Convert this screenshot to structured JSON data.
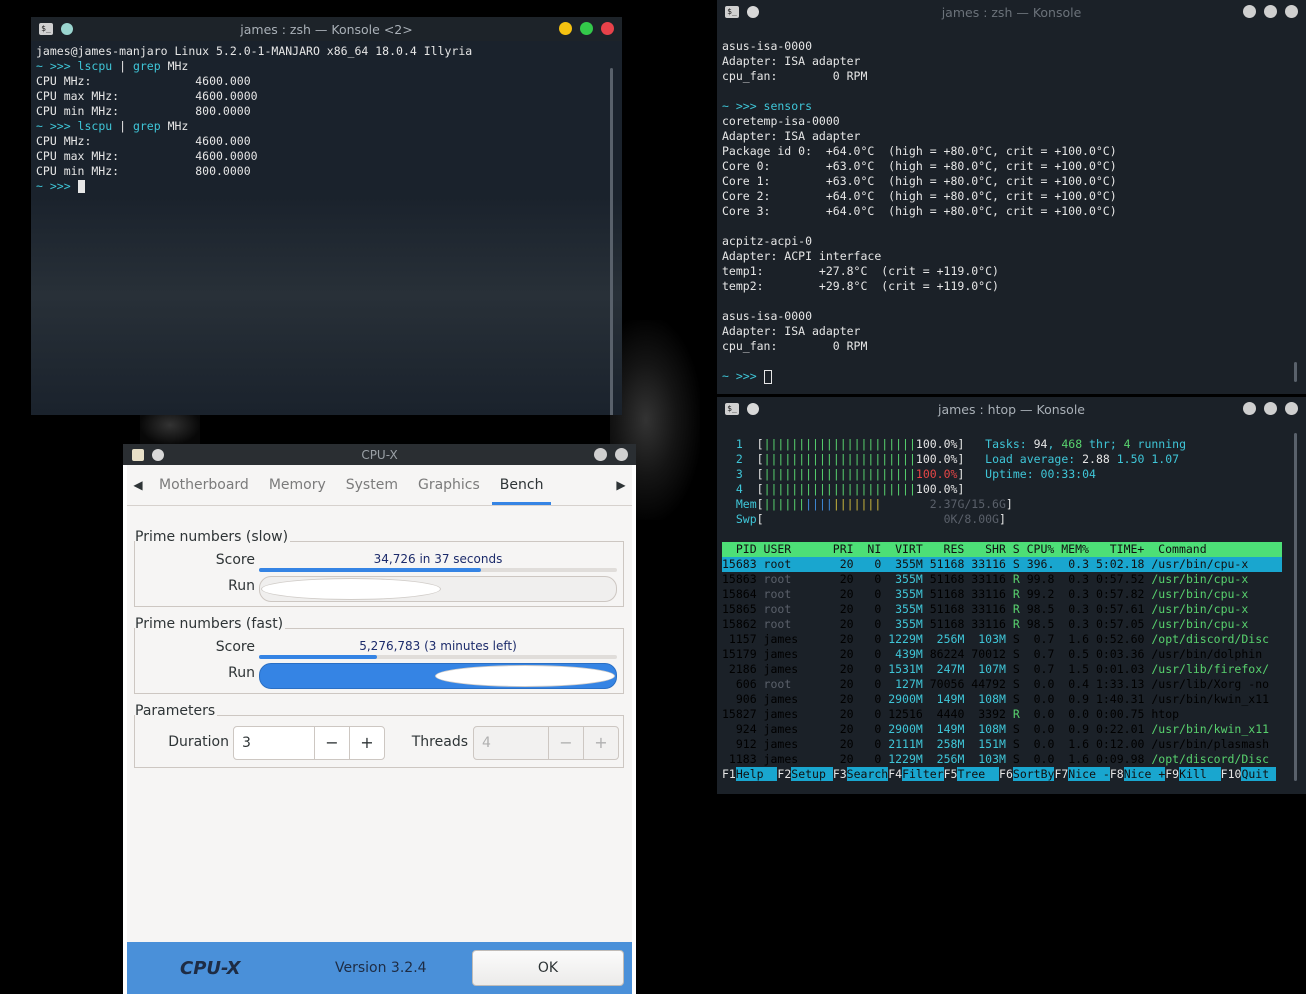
{
  "term1": {
    "title": "james : zsh — Konsole <2>",
    "lines": [
      "james@james-manjaro Linux 5.2.0-1-MANJARO x86_64 18.0.4 Illyria",
      "CPU MHz:               4600.000",
      "CPU max MHz:           4600.0000",
      "CPU min MHz:           800.0000",
      "CPU MHz:               4600.000",
      "CPU max MHz:           4600.0000",
      "CPU min MHz:           800.0000"
    ],
    "prompt": "~ >>> ",
    "cmd1": "lscpu",
    "pipe": " | ",
    "cmd2": "grep",
    "arg": " MHz"
  },
  "term2": {
    "title": "james : zsh — Konsole",
    "lines": [
      "asus-isa-0000",
      "Adapter: ISA adapter",
      "cpu_fan:        0 RPM",
      "",
      "~ >>> sensors",
      "coretemp-isa-0000",
      "Adapter: ISA adapter",
      "Package id 0:  +64.0°C  (high = +80.0°C, crit = +100.0°C)",
      "Core 0:        +63.0°C  (high = +80.0°C, crit = +100.0°C)",
      "Core 1:        +63.0°C  (high = +80.0°C, crit = +100.0°C)",
      "Core 2:        +64.0°C  (high = +80.0°C, crit = +100.0°C)",
      "Core 3:        +64.0°C  (high = +80.0°C, crit = +100.0°C)",
      "",
      "acpitz-acpi-0",
      "Adapter: ACPI interface",
      "temp1:        +27.8°C  (crit = +119.0°C)",
      "temp2:        +29.8°C  (crit = +119.0°C)",
      "",
      "asus-isa-0000",
      "Adapter: ISA adapter",
      "cpu_fan:        0 RPM",
      "",
      "~ >>> "
    ]
  },
  "htop": {
    "title": "james : htop — Konsole",
    "cpus": [
      {
        "n": "1",
        "pct": "100.0%"
      },
      {
        "n": "2",
        "pct": "100.0%"
      },
      {
        "n": "3",
        "pct": "100.0%"
      },
      {
        "n": "4",
        "pct": "100.0%"
      }
    ],
    "mem": "2.37G/15.6G",
    "swp": "0K/8.00G",
    "tasks": "94",
    "thr": "468",
    "running": "4",
    "load1": "2.88",
    "load5": "1.50",
    "load15": "1.07",
    "uptime": "00:33:04",
    "header": "  PID USER      PRI  NI  VIRT   RES   SHR S CPU% MEM%   TIME+  Command",
    "rows": [
      {
        "pid": "15683",
        "user": "root",
        "pri": "20",
        "ni": "0",
        "virt": "355M",
        "res": "51168",
        "shr": "33116",
        "s": "S",
        "cpu": "396.",
        "mem": "0.3",
        "time": "5:02.18",
        "cmd": "/usr/bin/cpu-x"
      },
      {
        "pid": "15863",
        "user": "root",
        "pri": "20",
        "ni": "0",
        "virt": "355M",
        "res": "51168",
        "shr": "33116",
        "s": "R",
        "cpu": "99.8",
        "mem": "0.3",
        "time": "0:57.52",
        "cmd": "/usr/bin/cpu-x"
      },
      {
        "pid": "15864",
        "user": "root",
        "pri": "20",
        "ni": "0",
        "virt": "355M",
        "res": "51168",
        "shr": "33116",
        "s": "R",
        "cpu": "99.2",
        "mem": "0.3",
        "time": "0:57.82",
        "cmd": "/usr/bin/cpu-x"
      },
      {
        "pid": "15865",
        "user": "root",
        "pri": "20",
        "ni": "0",
        "virt": "355M",
        "res": "51168",
        "shr": "33116",
        "s": "R",
        "cpu": "98.5",
        "mem": "0.3",
        "time": "0:57.61",
        "cmd": "/usr/bin/cpu-x"
      },
      {
        "pid": "15862",
        "user": "root",
        "pri": "20",
        "ni": "0",
        "virt": "355M",
        "res": "51168",
        "shr": "33116",
        "s": "R",
        "cpu": "98.5",
        "mem": "0.3",
        "time": "0:57.05",
        "cmd": "/usr/bin/cpu-x"
      },
      {
        "pid": "1157",
        "user": "james",
        "pri": "20",
        "ni": "0",
        "virt": "1229M",
        "res": "256M",
        "shr": "103M",
        "s": "S",
        "cpu": "0.7",
        "mem": "1.6",
        "time": "0:52.60",
        "cmd": "/opt/discord/Disc"
      },
      {
        "pid": "15179",
        "user": "james",
        "pri": "20",
        "ni": "0",
        "virt": "439M",
        "res": "86224",
        "shr": "70012",
        "s": "S",
        "cpu": "0.7",
        "mem": "0.5",
        "time": "0:03.36",
        "cmd": "/usr/bin/dolphin"
      },
      {
        "pid": "2186",
        "user": "james",
        "pri": "20",
        "ni": "0",
        "virt": "1531M",
        "res": "247M",
        "shr": "107M",
        "s": "S",
        "cpu": "0.7",
        "mem": "1.5",
        "time": "0:01.03",
        "cmd": "/usr/lib/firefox/"
      },
      {
        "pid": "606",
        "user": "root",
        "pri": "20",
        "ni": "0",
        "virt": "127M",
        "res": "70056",
        "shr": "44792",
        "s": "S",
        "cpu": "0.0",
        "mem": "0.4",
        "time": "1:33.13",
        "cmd": "/usr/lib/Xorg -no"
      },
      {
        "pid": "906",
        "user": "james",
        "pri": "20",
        "ni": "0",
        "virt": "2900M",
        "res": "149M",
        "shr": "108M",
        "s": "S",
        "cpu": "0.0",
        "mem": "0.9",
        "time": "1:40.31",
        "cmd": "/usr/bin/kwin_x11"
      },
      {
        "pid": "15827",
        "user": "james",
        "pri": "20",
        "ni": "0",
        "virt": "12516",
        "res": "4440",
        "shr": "3392",
        "s": "R",
        "cpu": "0.0",
        "mem": "0.0",
        "time": "0:00.75",
        "cmd": "htop"
      },
      {
        "pid": "924",
        "user": "james",
        "pri": "20",
        "ni": "0",
        "virt": "2900M",
        "res": "149M",
        "shr": "108M",
        "s": "S",
        "cpu": "0.0",
        "mem": "0.9",
        "time": "0:22.01",
        "cmd": "/usr/bin/kwin_x11"
      },
      {
        "pid": "912",
        "user": "james",
        "pri": "20",
        "ni": "0",
        "virt": "2111M",
        "res": "258M",
        "shr": "151M",
        "s": "S",
        "cpu": "0.0",
        "mem": "1.6",
        "time": "0:12.00",
        "cmd": "/usr/bin/plasmash"
      },
      {
        "pid": "1183",
        "user": "james",
        "pri": "20",
        "ni": "0",
        "virt": "1229M",
        "res": "256M",
        "shr": "103M",
        "s": "S",
        "cpu": "0.0",
        "mem": "1.6",
        "time": "0:09.98",
        "cmd": "/opt/discord/Disc"
      }
    ],
    "fkeys": [
      {
        "k": "F1",
        "l": "Help  "
      },
      {
        "k": "F2",
        "l": "Setup "
      },
      {
        "k": "F3",
        "l": "Search"
      },
      {
        "k": "F4",
        "l": "Filter"
      },
      {
        "k": "F5",
        "l": "Tree  "
      },
      {
        "k": "F6",
        "l": "SortBy"
      },
      {
        "k": "F7",
        "l": "Nice -"
      },
      {
        "k": "F8",
        "l": "Nice +"
      },
      {
        "k": "F9",
        "l": "Kill  "
      },
      {
        "k": "F10",
        "l": "Quit "
      }
    ]
  },
  "cpux": {
    "title": "CPU-X",
    "tabs": [
      "Motherboard",
      "Memory",
      "System",
      "Graphics",
      "Bench"
    ],
    "active_tab": "Bench",
    "slow": {
      "label": "Prime numbers (slow)",
      "score_label": "Score",
      "score_text": "34,726 in 37 seconds",
      "progress": 0.62,
      "run_label": "Run",
      "run_on": false
    },
    "fast": {
      "label": "Prime numbers (fast)",
      "score_label": "Score",
      "score_text": "5,276,783 (3 minutes left)",
      "progress": 0.33,
      "run_label": "Run",
      "run_on": true
    },
    "params": {
      "label": "Parameters",
      "duration_label": "Duration",
      "duration_value": "3",
      "threads_label": "Threads",
      "threads_value": "4",
      "minus": "−",
      "plus": "+"
    },
    "footer": {
      "logo": "CPU-X",
      "version": "Version 3.2.4",
      "ok": "OK"
    }
  }
}
